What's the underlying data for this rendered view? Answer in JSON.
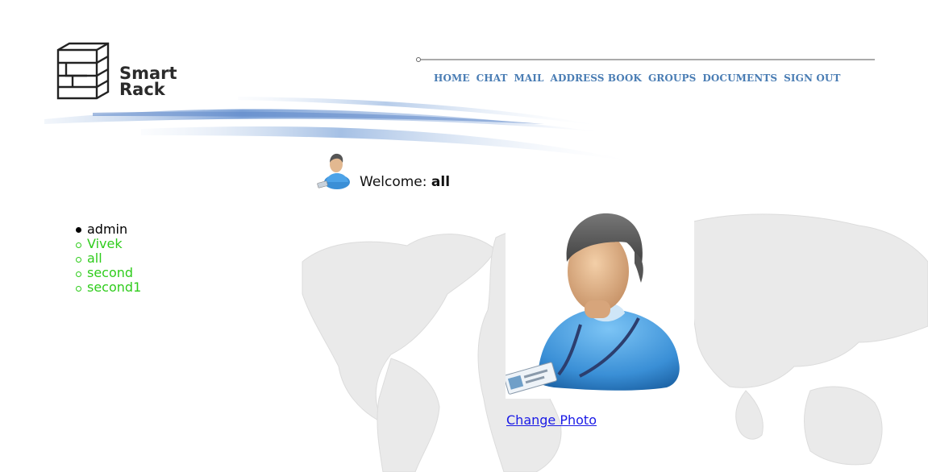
{
  "logo": {
    "line1": "Smart",
    "line2": "Rack"
  },
  "nav": {
    "items": [
      {
        "label": "HOME"
      },
      {
        "label": "CHAT"
      },
      {
        "label": "MAIL"
      },
      {
        "label": "ADDRESS BOOK"
      },
      {
        "label": "GROUPS"
      },
      {
        "label": "DOCUMENTS"
      },
      {
        "label": "SIGN OUT"
      }
    ]
  },
  "welcome": {
    "label": "Welcome:",
    "user": "all"
  },
  "users": {
    "items": [
      {
        "label": "admin",
        "state": "current"
      },
      {
        "label": "Vivek",
        "state": "other"
      },
      {
        "label": "all",
        "state": "other"
      },
      {
        "label": "second",
        "state": "other"
      },
      {
        "label": "second1",
        "state": "other"
      }
    ]
  },
  "profile": {
    "change_photo_label": "Change Photo"
  },
  "colors": {
    "nav": "#4a7db4",
    "online_user": "#2fcc1c",
    "link": "#1a1ae6"
  },
  "icons": {
    "logo": "rack-icon",
    "small_user": "user-icon",
    "avatar": "user-avatar-icon",
    "map": "world-map-background"
  }
}
